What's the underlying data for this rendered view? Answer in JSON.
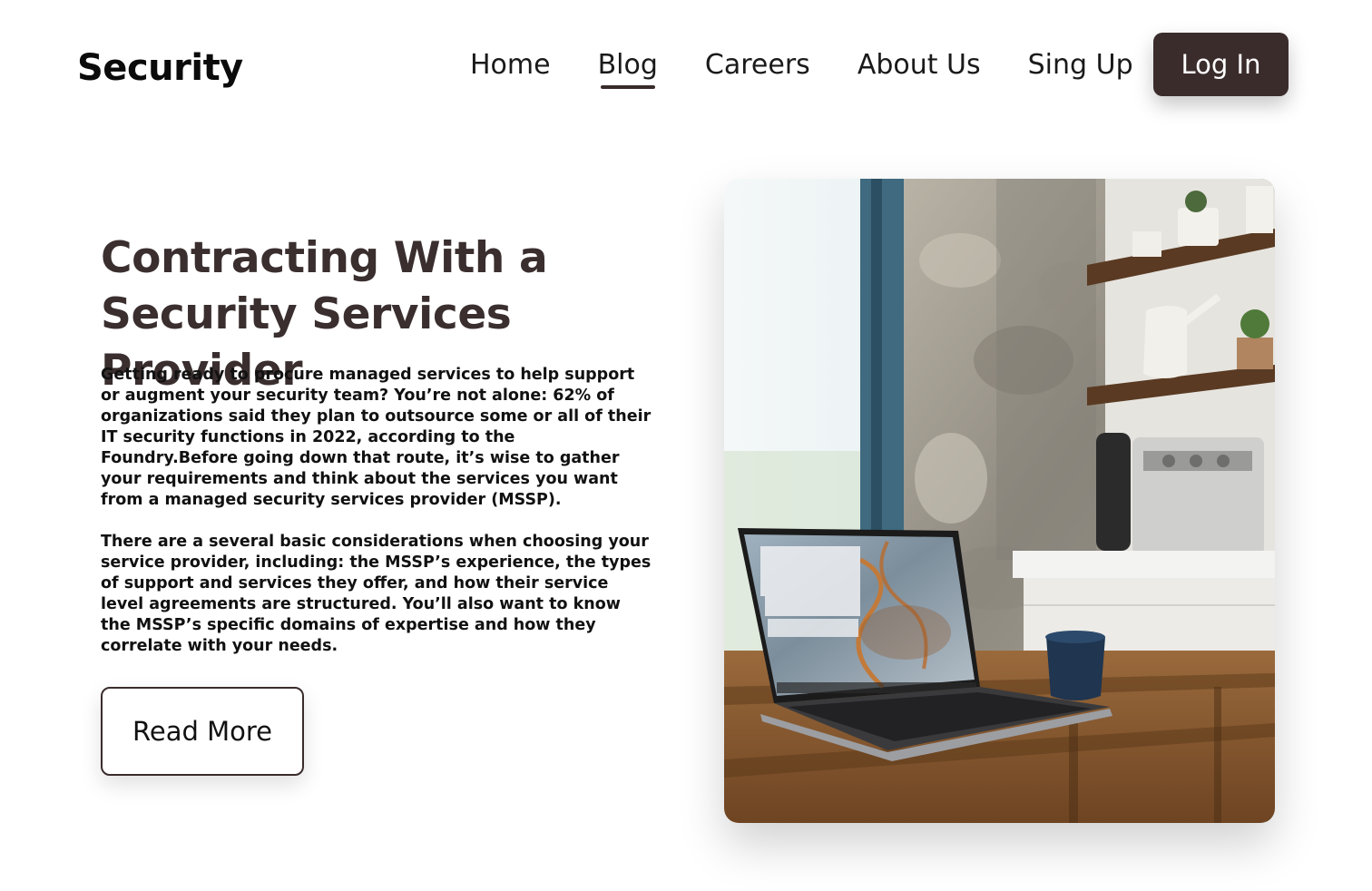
{
  "brand": {
    "logo": "Security"
  },
  "nav": {
    "items": [
      {
        "label": "Home",
        "active": false
      },
      {
        "label": "Blog",
        "active": true
      },
      {
        "label": "Careers",
        "active": false
      },
      {
        "label": "About Us",
        "active": false
      },
      {
        "label": "Sing Up",
        "active": false
      }
    ],
    "login_label": "Log In"
  },
  "article": {
    "title": "Contracting With a Security Services Provider",
    "paragraphs": [
      "Getting ready to procure managed services to help support or augment your security team? You’re not alone: 62% of organizations said they plan to outsource some or all of their IT security functions in 2022, according to the Foundry.Before going down that route, it’s wise to gather your requirements and think about the services you want from a managed security services provider (MSSP).",
      "There are a several basic considerations when choosing your service provider, including: the MSSP’s experience, the types of support and services they offer, and how their service level agreements are structured. You’ll also want to know the MSSP’s specific domains of expertise and how they correlate with your needs."
    ],
    "read_more_label": "Read More"
  },
  "hero_image": {
    "subject": "laptop-on-wooden-table-photo"
  },
  "colors": {
    "accent": "#3b2c2c",
    "title": "#3a2e2e",
    "text": "#111111",
    "background": "#ffffff"
  }
}
